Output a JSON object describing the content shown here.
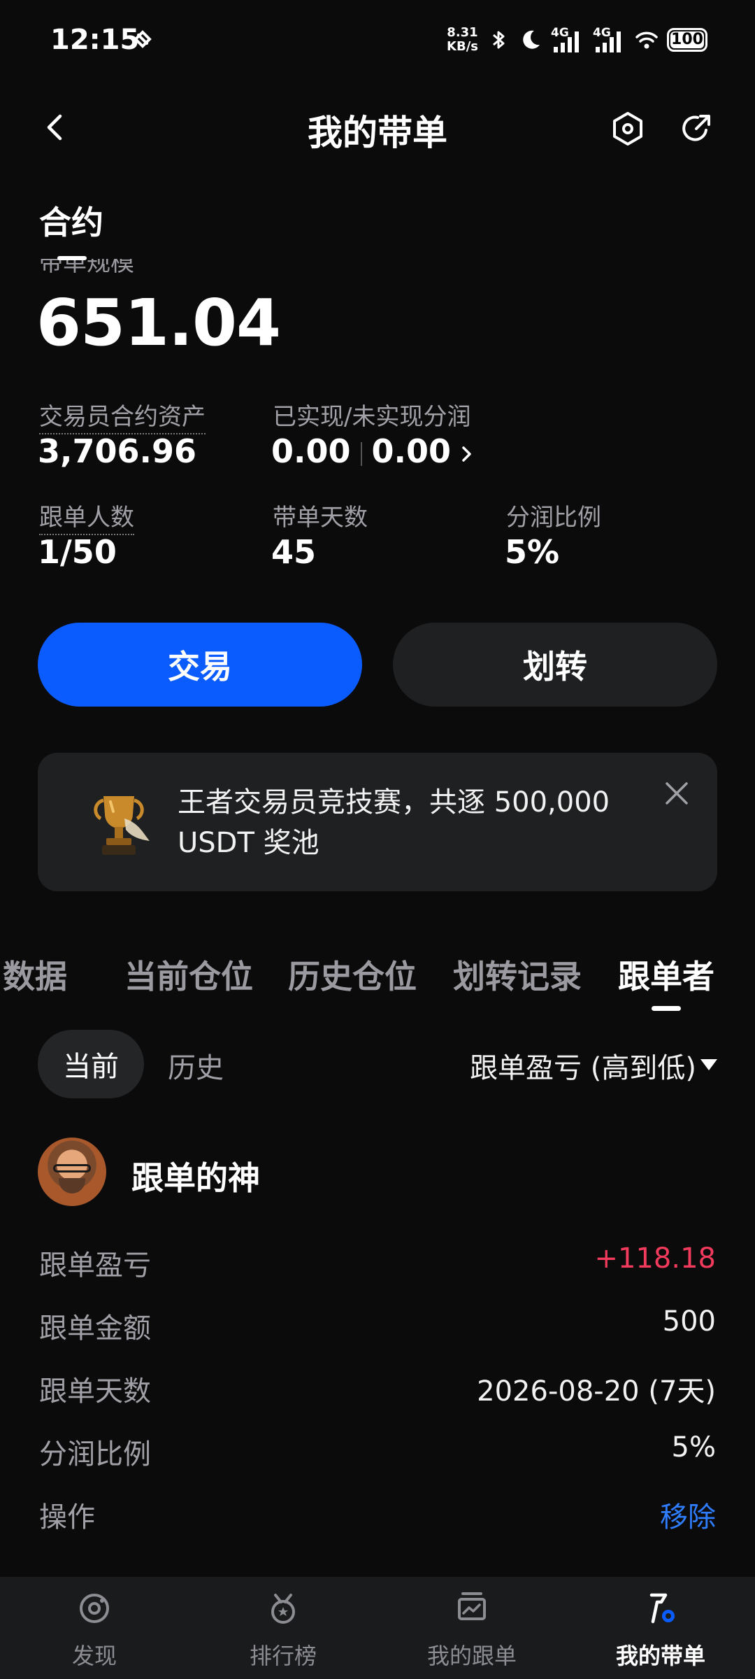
{
  "status_bar": {
    "time": "12:15",
    "net_speed_value": "8.31",
    "net_speed_unit": "KB/s",
    "signal1_label": "4G",
    "signal2_label": "4G",
    "battery": "100"
  },
  "header": {
    "title": "我的带单"
  },
  "summary": {
    "section_title": "合约",
    "hidden_label": "带单规模",
    "big_value": "651.04",
    "trader_assets_label": "交易员合约资产",
    "trader_assets_value": "3,706.96",
    "profit_share_label": "已实现/未实现分润",
    "realized_value": "0.00",
    "unrealized_value": "0.00",
    "followers_label": "跟单人数",
    "followers_value": "1/50",
    "days_label": "带单天数",
    "days_value": "45",
    "share_ratio_label": "分润比例",
    "share_ratio_value": "5%"
  },
  "actions": {
    "trade_label": "交易",
    "transfer_label": "划转"
  },
  "banner": {
    "text": "王者交易员竞技赛，共逐 500,000 USDT 奖池"
  },
  "tabs": [
    {
      "label": "数据"
    },
    {
      "label": "当前仓位"
    },
    {
      "label": "历史仓位"
    },
    {
      "label": "划转记录"
    },
    {
      "label": "跟单者"
    }
  ],
  "filter": {
    "current_label": "当前",
    "history_label": "历史",
    "sort_label": "跟单盈亏 (高到低)"
  },
  "follower": {
    "name": "跟单的神",
    "rows": [
      {
        "label": "跟单盈亏",
        "value": "+118.18"
      },
      {
        "label": "跟单金额",
        "value": "500"
      },
      {
        "label": "跟单天数",
        "value": "2026-08-20 (7天)"
      },
      {
        "label": "分润比例",
        "value": "5%"
      },
      {
        "label": "操作",
        "value": "移除"
      }
    ]
  },
  "bottom_nav": [
    {
      "label": "发现",
      "icon": "discover-icon"
    },
    {
      "label": "排行榜",
      "icon": "leaderboard-icon"
    },
    {
      "label": "我的跟单",
      "icon": "my-copy-icon"
    },
    {
      "label": "我的带单",
      "icon": "my-lead-icon"
    }
  ],
  "colors": {
    "accent": "#0a5cff",
    "profit": "#f23b5c",
    "link": "#2f7dff",
    "background": "#0b0b0c"
  }
}
